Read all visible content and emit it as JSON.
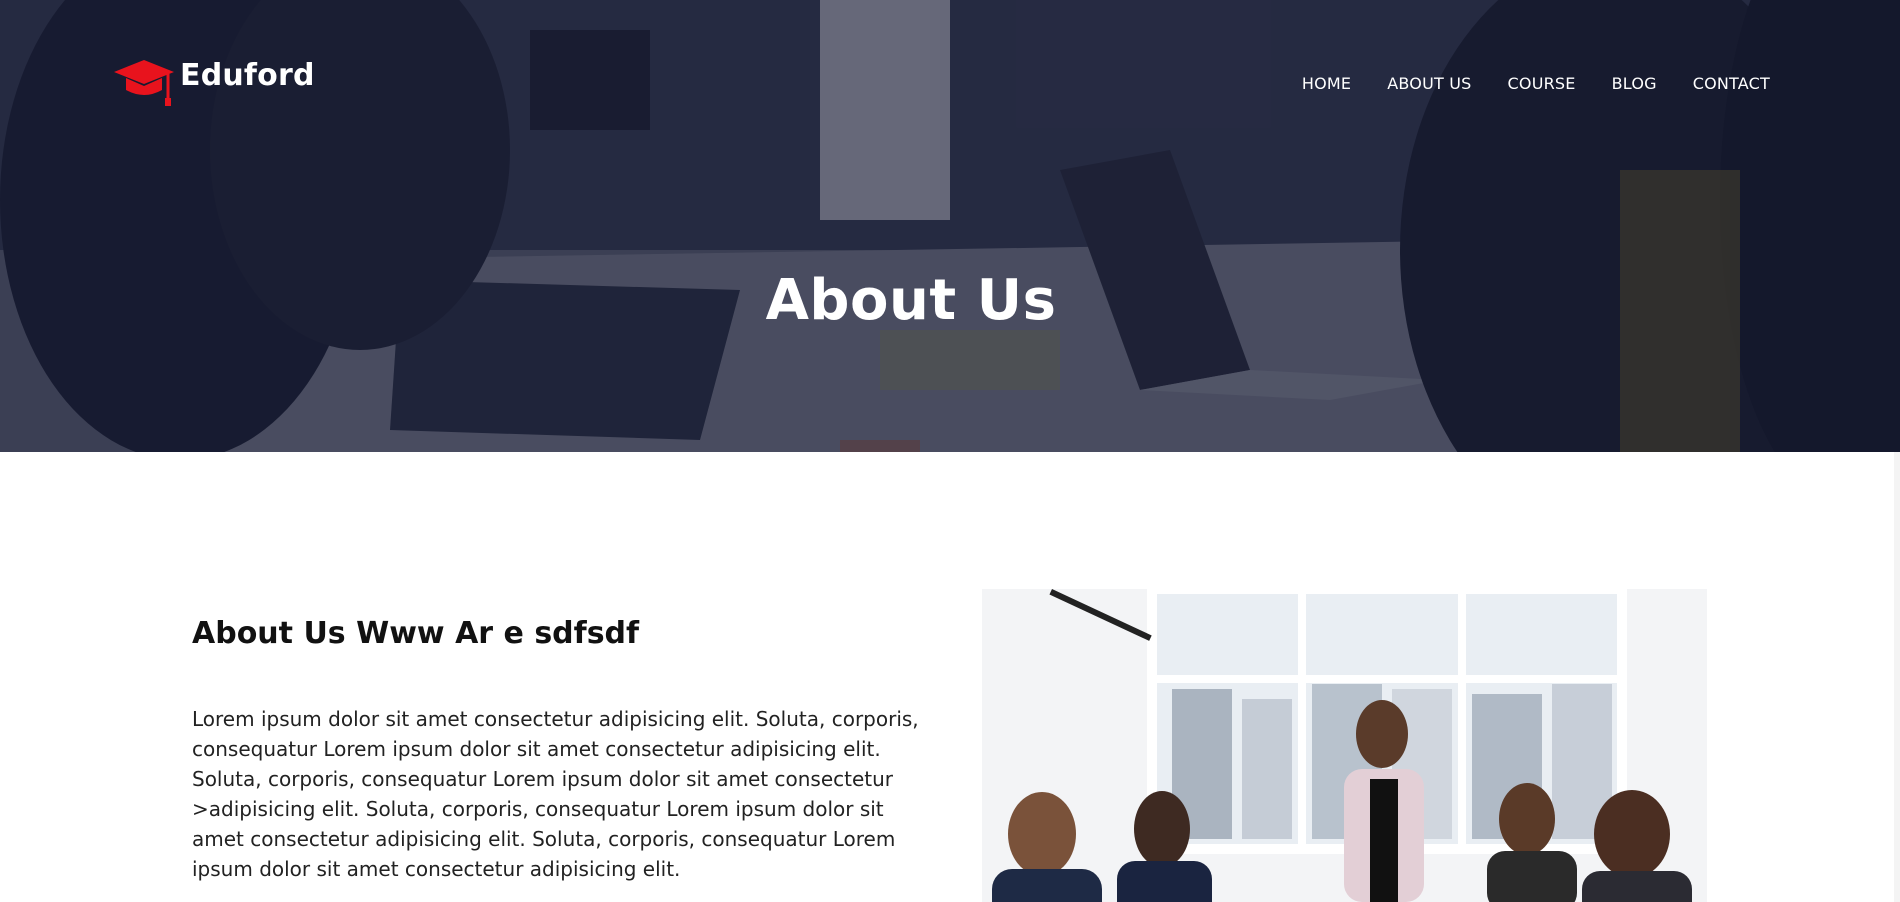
{
  "header": {
    "logo_text": "Eduford",
    "logo_icon": "graduation-cap-icon",
    "nav": [
      {
        "label": "HOME"
      },
      {
        "label": "ABOUT US"
      },
      {
        "label": "COURSE"
      },
      {
        "label": "BLOG"
      },
      {
        "label": "CONTACT"
      }
    ]
  },
  "hero": {
    "title": "About Us"
  },
  "about": {
    "heading": "About Us Www Ar e sdfsdf",
    "paragraph": "Lorem ipsum dolor sit amet consectetur adipisicing elit. Soluta, corporis, consequatur Lorem ipsum dolor sit amet consectetur adipisicing elit. Soluta, corporis, consequatur Lorem ipsum dolor sit amet consectetur >adipisicing elit. Soluta, corporis, consequatur Lorem ipsum dolor sit amet consectetur adipisicing elit. Soluta, corporis, consequatur Lorem ipsum dolor sit amet consectetur adipisicing elit."
  },
  "colors": {
    "brand_red": "#e8131d",
    "hero_overlay": "#141830"
  }
}
